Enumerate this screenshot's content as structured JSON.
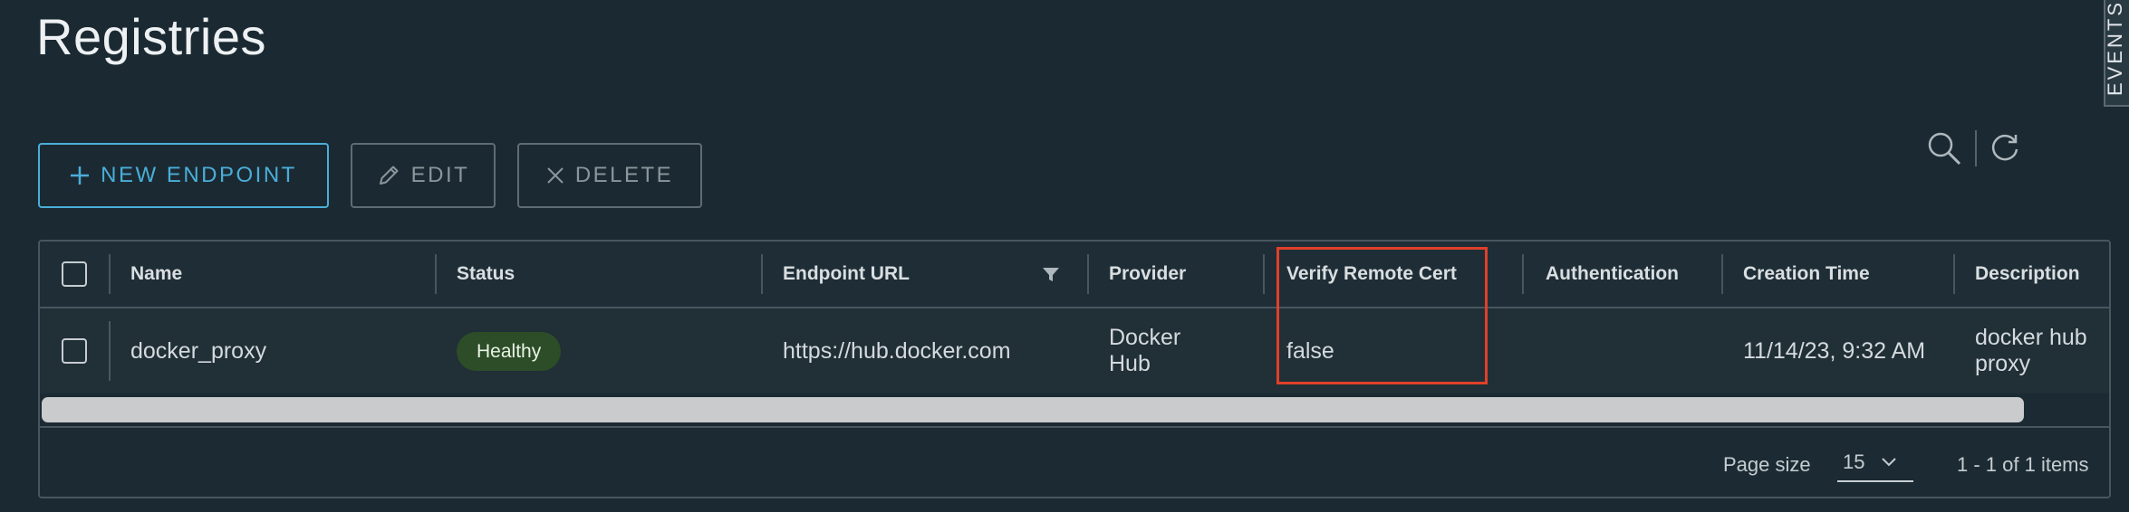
{
  "page": {
    "title": "Registries"
  },
  "side_tab": {
    "label": "EVENTS"
  },
  "toolbar": {
    "new_label": "NEW ENDPOINT",
    "edit_label": "EDIT",
    "delete_label": "DELETE"
  },
  "table": {
    "columns": [
      "Name",
      "Status",
      "Endpoint URL",
      "Provider",
      "Verify Remote Cert",
      "Authentication",
      "Creation Time",
      "Description"
    ],
    "rows": [
      {
        "name": "docker_proxy",
        "status": "Healthy",
        "endpoint_url": "https://hub.docker.com",
        "provider": "Docker Hub",
        "verify_remote_cert": "false",
        "authentication": "",
        "creation_time": "11/14/23, 9:32 AM",
        "description": "docker hub proxy"
      }
    ],
    "footer": {
      "page_size_label": "Page size",
      "page_size_value": "15",
      "items_summary": "1 - 1 of 1 items"
    }
  },
  "colors": {
    "accent": "#4aaed9",
    "status_healthy_bg": "#2c4d27",
    "highlight": "#e0402a"
  },
  "icons": [
    "plus-icon",
    "pencil-icon",
    "close-icon",
    "search-icon",
    "refresh-icon",
    "filter-icon",
    "chevron-down-icon"
  ]
}
